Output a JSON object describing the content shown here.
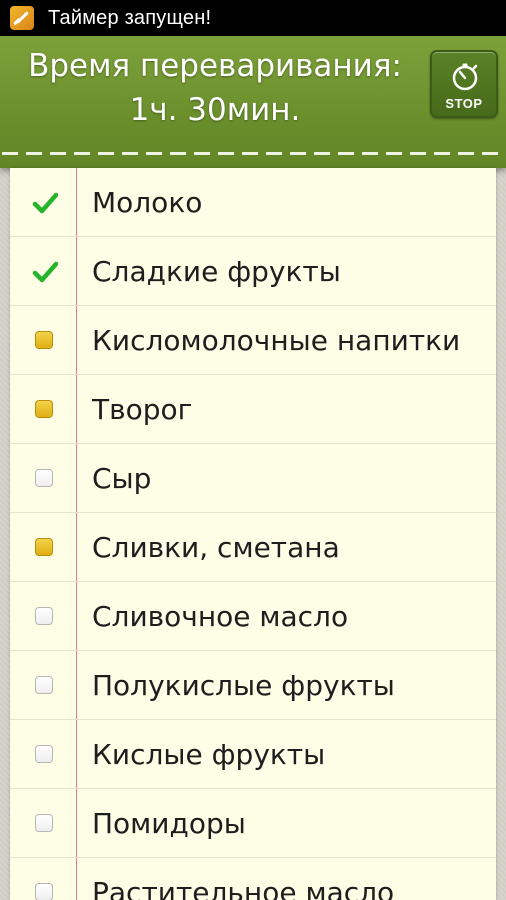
{
  "status_bar": {
    "notification_text": "Таймер запущен!",
    "app_icon": "timer-app-icon"
  },
  "header": {
    "title": "Время переваривания:",
    "time": "1ч. 30мин.",
    "stop_label": "STOP",
    "stop_icon": "stopwatch-icon",
    "bg_color": "#6b8f2c"
  },
  "items": [
    {
      "label": "Молоко",
      "state": "checked"
    },
    {
      "label": "Сладкие фрукты",
      "state": "checked"
    },
    {
      "label": "Кисломолочные напитки",
      "state": "yellow"
    },
    {
      "label": "Творог",
      "state": "yellow"
    },
    {
      "label": "Сыр",
      "state": "empty"
    },
    {
      "label": "Сливки, сметана",
      "state": "yellow"
    },
    {
      "label": "Сливочное масло",
      "state": "empty"
    },
    {
      "label": "Полукислые фрукты",
      "state": "empty"
    },
    {
      "label": "Кислые фрукты",
      "state": "empty"
    },
    {
      "label": "Помидоры",
      "state": "empty"
    },
    {
      "label": "Растительное масло",
      "state": "empty"
    }
  ],
  "colors": {
    "check": "#26b52a",
    "yellow_box": "#e8bd1e",
    "margin_line": "#e07c7c",
    "paper": "#fefde6"
  }
}
